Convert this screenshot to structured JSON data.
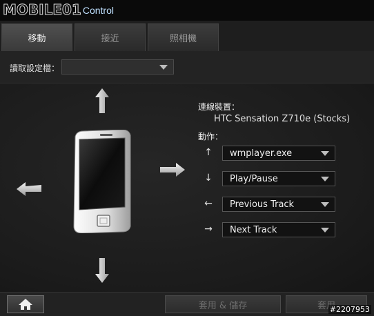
{
  "app": {
    "brand": "MOBILE01",
    "product": "Control"
  },
  "tabs": [
    {
      "label": "移動",
      "active": true
    },
    {
      "label": "接近",
      "active": false
    },
    {
      "label": "照相機",
      "active": false
    }
  ],
  "profile": {
    "label": "讀取設定檔：",
    "value": ""
  },
  "connection": {
    "label": "連線裝置：",
    "device": "HTC Sensation Z710e (Stocks)"
  },
  "actions": {
    "label": "動作：",
    "rows": [
      {
        "direction_icon": "arrow-up-icon",
        "glyph": "↑",
        "value": "wmplayer.exe"
      },
      {
        "direction_icon": "arrow-down-icon",
        "glyph": "↓",
        "value": "Play/Pause"
      },
      {
        "direction_icon": "arrow-left-icon",
        "glyph": "←",
        "value": "Previous Track"
      },
      {
        "direction_icon": "arrow-right-icon",
        "glyph": "→",
        "value": "Next Track"
      }
    ]
  },
  "footer": {
    "apply_save_label": "套用 & 儲存",
    "apply_label": "套用"
  },
  "watermark": "#2207953",
  "colors": {
    "background": "#1c1c1c",
    "tab_active": "#505050",
    "select_bg": "#121212"
  }
}
